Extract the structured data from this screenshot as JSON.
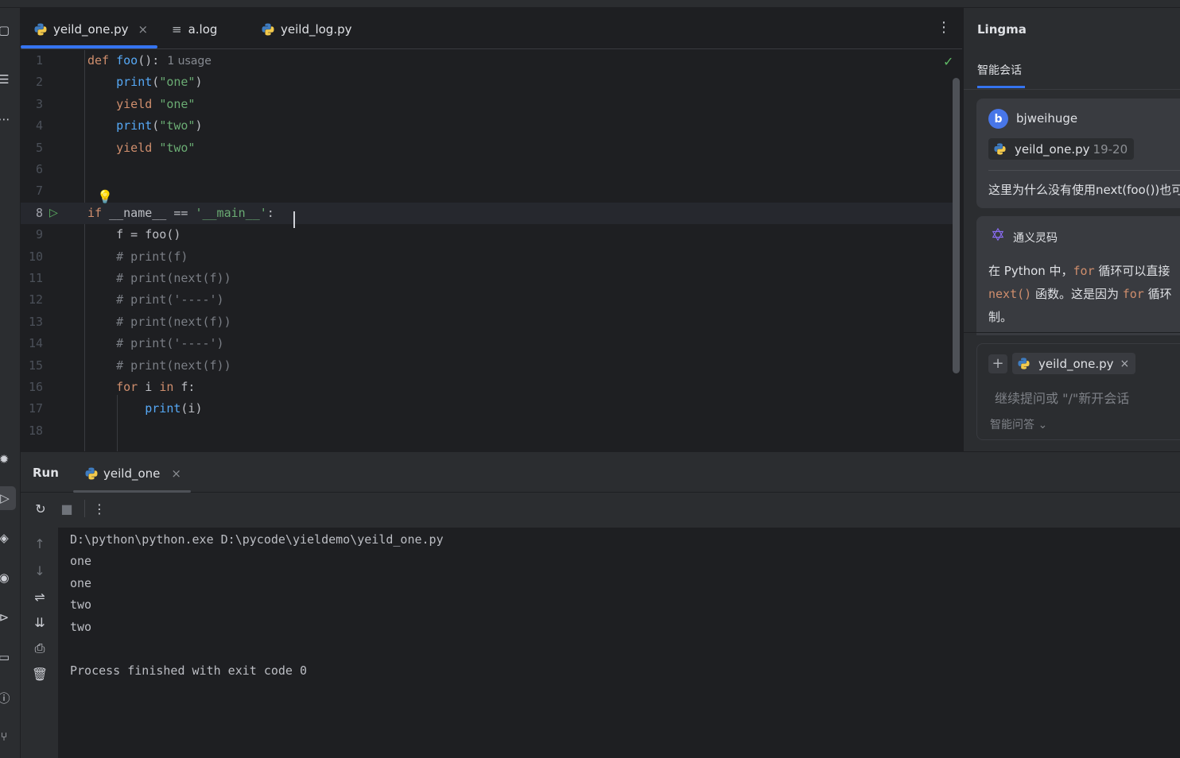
{
  "editor": {
    "tabs": [
      {
        "label": "yeild_one.py",
        "icon": "python-file-icon",
        "active": true,
        "close": "×"
      },
      {
        "label": "a.log",
        "icon": "text-file-icon"
      },
      {
        "label": "yeild_log.py",
        "icon": "python-file-icon"
      }
    ],
    "menu_glyph": "⋮",
    "inspection_glyph": "✓",
    "usage_hint": "1 usage",
    "current_line": 8,
    "lines": [
      {
        "n": "1",
        "tokens": [
          {
            "t": "def ",
            "c": "kw"
          },
          {
            "t": "foo",
            "c": "fn"
          },
          {
            "t": "():",
            "c": ""
          }
        ]
      },
      {
        "n": "2",
        "tokens": [
          {
            "t": "    ",
            "c": ""
          },
          {
            "t": "print",
            "c": "fn"
          },
          {
            "t": "(",
            "c": ""
          },
          {
            "t": "\"one\"",
            "c": "str"
          },
          {
            "t": ")",
            "c": ""
          }
        ]
      },
      {
        "n": "3",
        "tokens": [
          {
            "t": "    ",
            "c": ""
          },
          {
            "t": "yield ",
            "c": "kw"
          },
          {
            "t": "\"one\"",
            "c": "str"
          }
        ]
      },
      {
        "n": "4",
        "tokens": [
          {
            "t": "    ",
            "c": ""
          },
          {
            "t": "print",
            "c": "fn"
          },
          {
            "t": "(",
            "c": ""
          },
          {
            "t": "\"two\"",
            "c": "str"
          },
          {
            "t": ")",
            "c": ""
          }
        ]
      },
      {
        "n": "5",
        "tokens": [
          {
            "t": "    ",
            "c": ""
          },
          {
            "t": "yield ",
            "c": "kw"
          },
          {
            "t": "\"two\"",
            "c": "str"
          }
        ]
      },
      {
        "n": "6",
        "tokens": []
      },
      {
        "n": "7",
        "tokens": []
      },
      {
        "n": "8",
        "tokens": [
          {
            "t": "if ",
            "c": "kw"
          },
          {
            "t": "__name__ == ",
            "c": ""
          },
          {
            "t": "'__main__'",
            "c": "str"
          },
          {
            "t": ":",
            "c": ""
          }
        ]
      },
      {
        "n": "9",
        "tokens": [
          {
            "t": "    f = foo()",
            "c": ""
          }
        ]
      },
      {
        "n": "10",
        "tokens": [
          {
            "t": "    ",
            "c": ""
          },
          {
            "t": "# print(f)",
            "c": "cm"
          }
        ]
      },
      {
        "n": "11",
        "tokens": [
          {
            "t": "    ",
            "c": ""
          },
          {
            "t": "# print(next(f))",
            "c": "cm"
          }
        ]
      },
      {
        "n": "12",
        "tokens": [
          {
            "t": "    ",
            "c": ""
          },
          {
            "t": "# print('----')",
            "c": "cm"
          }
        ]
      },
      {
        "n": "13",
        "tokens": [
          {
            "t": "    ",
            "c": ""
          },
          {
            "t": "# print(next(f))",
            "c": "cm"
          }
        ]
      },
      {
        "n": "14",
        "tokens": [
          {
            "t": "    ",
            "c": ""
          },
          {
            "t": "# print('----')",
            "c": "cm"
          }
        ]
      },
      {
        "n": "15",
        "tokens": [
          {
            "t": "    ",
            "c": ""
          },
          {
            "t": "# print(next(f))",
            "c": "cm"
          }
        ]
      },
      {
        "n": "16",
        "tokens": [
          {
            "t": "    ",
            "c": ""
          },
          {
            "t": "for ",
            "c": "kw"
          },
          {
            "t": "i ",
            "c": ""
          },
          {
            "t": "in ",
            "c": "kw"
          },
          {
            "t": "f:",
            "c": ""
          }
        ]
      },
      {
        "n": "17",
        "tokens": [
          {
            "t": "        ",
            "c": ""
          },
          {
            "t": "print",
            "c": "fn"
          },
          {
            "t": "(i)",
            "c": ""
          }
        ]
      },
      {
        "n": "18",
        "tokens": []
      }
    ]
  },
  "lingma": {
    "title": "Lingma",
    "tab": "智能会话",
    "user": {
      "avatar_letter": "b",
      "name": "bjweihuge",
      "file": "yeild_one.py",
      "range": "19-20",
      "message": "这里为什么没有使用next(foo())也可以"
    },
    "ai": {
      "name": "通义灵码",
      "line1_a": "在 Python 中，",
      "line1_code": "for",
      "line1_b": " 循环可以直接",
      "line2_code": "next()",
      "line2_a": " 函数。这是因为 ",
      "line2_code2": "for",
      "line2_b": " 循环",
      "line3": "制。"
    },
    "input": {
      "add_glyph": "+",
      "file": "yeild_one.py",
      "close": "×",
      "placeholder": "继续提问或 \"/\"新开会话",
      "mode": "智能问答 ⌄"
    }
  },
  "run": {
    "title": "Run",
    "tab": "yeild_one",
    "tab_close": "×",
    "console": [
      "D:\\python\\python.exe D:\\pycode\\yieldemo\\yeild_one.py",
      "one",
      "one",
      "two",
      "two",
      "",
      "Process finished with exit code 0"
    ]
  },
  "colors": {
    "accent": "#3574f0",
    "keyword": "#cf8e6d",
    "function": "#56a8f5",
    "string": "#6aab73",
    "comment": "#7a7e85",
    "run_green": "#5fb865",
    "bulb": "#f2c55c"
  }
}
